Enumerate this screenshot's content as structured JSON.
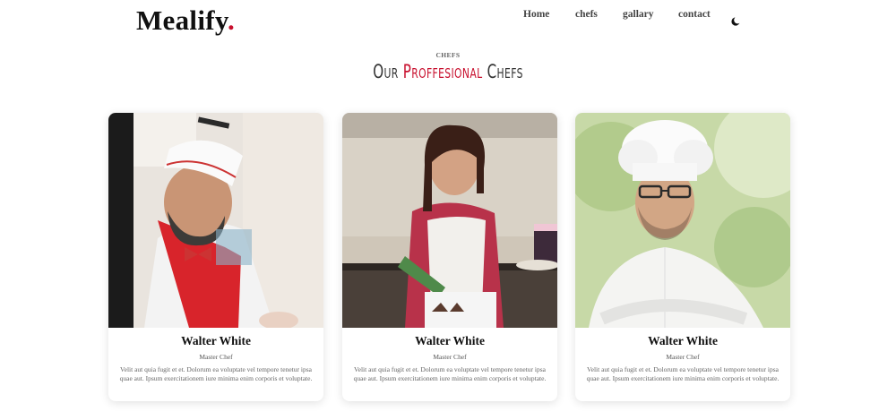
{
  "brand": {
    "name": "Mealify",
    "dot": ".",
    "accent_color": "#c8102e"
  },
  "nav": {
    "items": [
      {
        "label": "Home"
      },
      {
        "label": "chefs"
      },
      {
        "label": "gallary"
      },
      {
        "label": "contact"
      }
    ],
    "theme_toggle_icon": "moon-icon"
  },
  "section": {
    "eyebrow": "CHEFS",
    "title_prefix": "Our ",
    "title_accent": "Proffesional",
    "title_suffix": " Chefs"
  },
  "chefs": [
    {
      "name": "Walter White",
      "role": "Master Chef",
      "description": "Velit aut quia fugit et et. Dolorum ea voluptate vel tempore tenetur ipsa quae aut. Ipsum exercitationem iure minima enim corporis et voluptate.",
      "photo_icon": "chef-photo-red-apron"
    },
    {
      "name": "Walter White",
      "role": "Master Chef",
      "description": "Velit aut quia fugit et et. Dolorum ea voluptate vel tempore tenetur ipsa quae aut. Ipsum exercitationem iure minima enim corporis et voluptate.",
      "photo_icon": "chef-photo-pastry"
    },
    {
      "name": "Walter White",
      "role": "Master Chef",
      "description": "Velit aut quia fugit et et. Dolorum ea voluptate vel tempore tenetur ipsa quae aut. Ipsum exercitationem iure minima enim corporis et voluptate.",
      "photo_icon": "chef-photo-white-uniform"
    }
  ]
}
